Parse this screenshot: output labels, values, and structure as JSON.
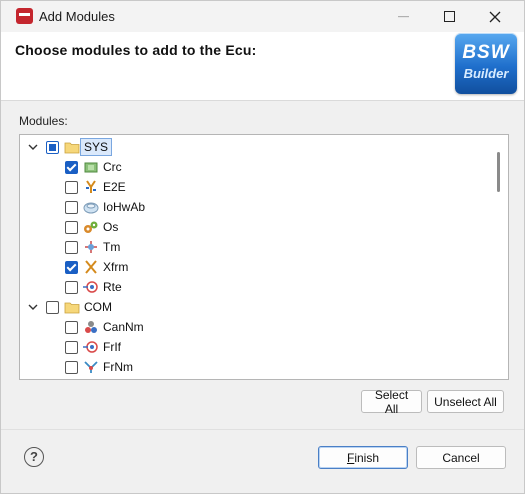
{
  "window": {
    "title": "Add Modules"
  },
  "header": {
    "title": "Choose modules to add to the Ecu:",
    "logo_line1": "BSW",
    "logo_line2": "Builder"
  },
  "modules_label": "Modules:",
  "tree": [
    {
      "label": "SYS",
      "level": 0,
      "expanded": true,
      "state": "partial",
      "icon": "folder-icon",
      "selected": true
    },
    {
      "label": "Crc",
      "level": 1,
      "state": "checked",
      "icon": "crc-module-icon"
    },
    {
      "label": "E2E",
      "level": 1,
      "state": "unchecked",
      "icon": "e2e-module-icon"
    },
    {
      "label": "IoHwAb",
      "level": 1,
      "state": "unchecked",
      "icon": "iohwab-module-icon"
    },
    {
      "label": "Os",
      "level": 1,
      "state": "unchecked",
      "icon": "os-module-icon"
    },
    {
      "label": "Tm",
      "level": 1,
      "state": "unchecked",
      "icon": "tm-module-icon"
    },
    {
      "label": "Xfrm",
      "level": 1,
      "state": "checked",
      "icon": "xfrm-module-icon"
    },
    {
      "label": "Rte",
      "level": 1,
      "state": "unchecked",
      "icon": "rte-module-icon"
    },
    {
      "label": "COM",
      "level": 0,
      "expanded": true,
      "state": "unchecked",
      "icon": "folder-icon"
    },
    {
      "label": "CanNm",
      "level": 1,
      "state": "unchecked",
      "icon": "cannm-module-icon"
    },
    {
      "label": "FrIf",
      "level": 1,
      "state": "unchecked",
      "icon": "frif-module-icon"
    },
    {
      "label": "FrNm",
      "level": 1,
      "state": "unchecked",
      "icon": "frnm-module-icon"
    }
  ],
  "buttons": {
    "select_all": "Select All",
    "unselect_all": "Unselect All",
    "finish": "Finish",
    "cancel": "Cancel",
    "help": "?"
  }
}
